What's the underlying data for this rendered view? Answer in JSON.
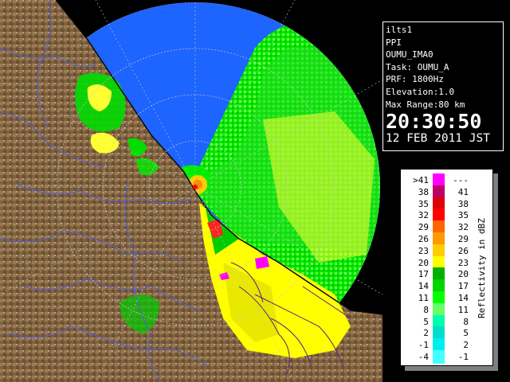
{
  "info": {
    "lines": [
      "ilts1",
      "PPI",
      "OUMU_IMA0",
      "Task: OUMU_A",
      "PRF: 1800Hz",
      "Elevation:1.0",
      "Max Range:80 km"
    ],
    "time": "20:30:50",
    "date": "12 FEB 2011 JST"
  },
  "legend": {
    "title": "Reflectivity in dBZ",
    "rows": [
      {
        "lo": ">41",
        "hi": "---",
        "color": "#ff00ff"
      },
      {
        "lo": "38",
        "hi": "41",
        "color": "#bb0066"
      },
      {
        "lo": "35",
        "hi": "38",
        "color": "#dd0000"
      },
      {
        "lo": "32",
        "hi": "35",
        "color": "#ff0000"
      },
      {
        "lo": "29",
        "hi": "32",
        "color": "#ff6600"
      },
      {
        "lo": "26",
        "hi": "29",
        "color": "#ff9900"
      },
      {
        "lo": "23",
        "hi": "26",
        "color": "#ffcc00"
      },
      {
        "lo": "20",
        "hi": "23",
        "color": "#ffff00"
      },
      {
        "lo": "17",
        "hi": "20",
        "color": "#00b000"
      },
      {
        "lo": "14",
        "hi": "17",
        "color": "#00d400"
      },
      {
        "lo": "11",
        "hi": "14",
        "color": "#00ff00"
      },
      {
        "lo": "8",
        "hi": "11",
        "color": "#66ff66"
      },
      {
        "lo": "5",
        "hi": "8",
        "color": "#00ffaa"
      },
      {
        "lo": "2",
        "hi": "5",
        "color": "#00ddcc"
      },
      {
        "lo": "-1",
        "hi": "2",
        "color": "#00eeee"
      },
      {
        "lo": "-4",
        "hi": "-1",
        "color": "#44ffff"
      }
    ]
  },
  "map": {
    "land_color": "#8a6a45",
    "sea_color": "#000000",
    "scan_color": "#1e64ff",
    "range_ring_color": "#c8c8c8"
  }
}
